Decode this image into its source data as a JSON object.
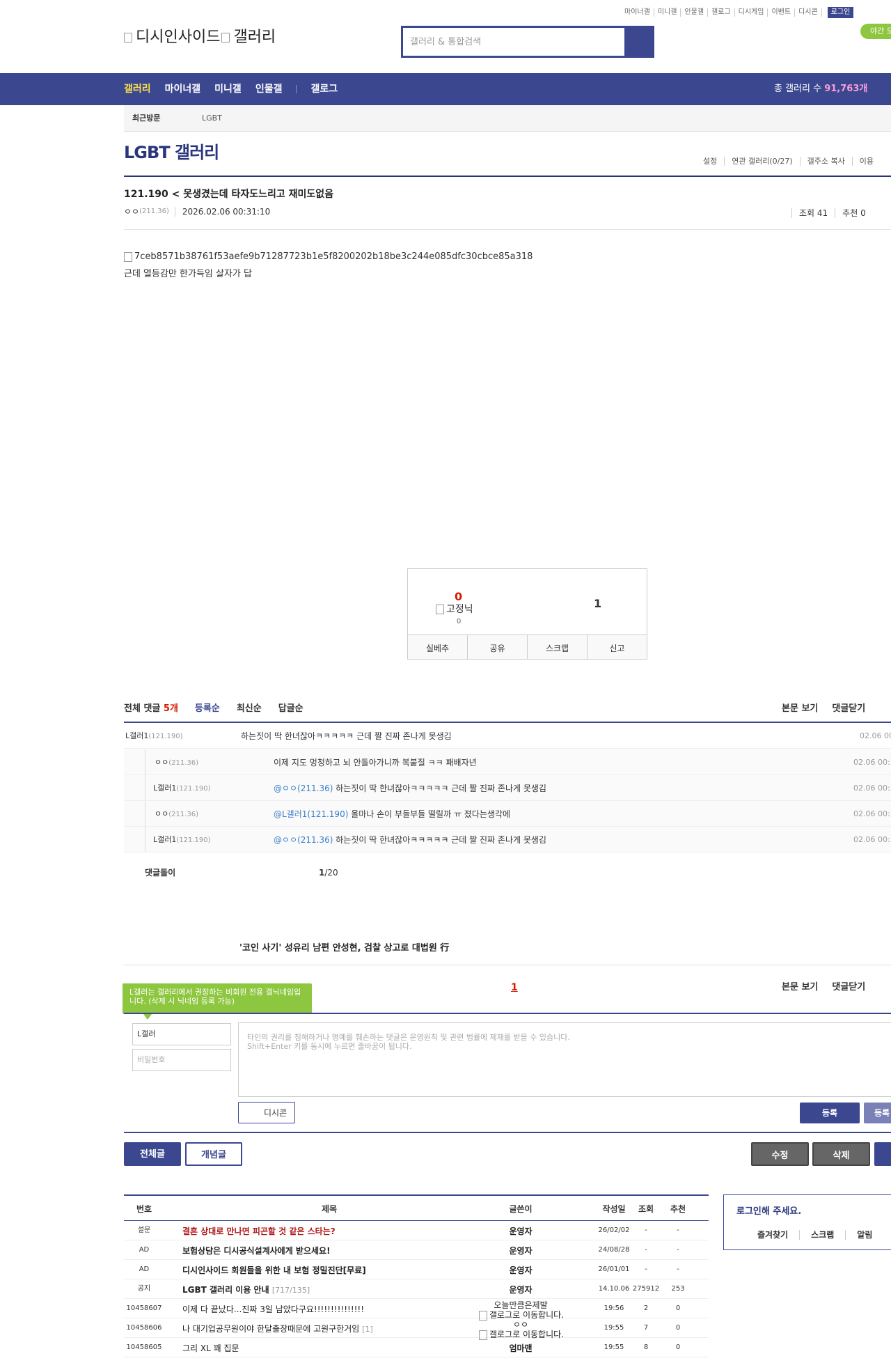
{
  "util_links": [
    "마이너갤",
    "미니갤",
    "인물갤",
    "갤로그",
    "디시게임",
    "이벤트",
    "디시콘"
  ],
  "login_label": "로그인",
  "night_mode": "야간 모",
  "logo": {
    "left": "디시인사이드",
    "right": "갤러리"
  },
  "search": {
    "placeholder": "갤러리 & 통합검색"
  },
  "nav": {
    "items": [
      "갤러리",
      "마이너갤",
      "미니갤",
      "인물갤",
      "갤로그"
    ],
    "total_label": "총 갤러리 수",
    "total_value": "91,763개"
  },
  "recent": {
    "title": "최근방문",
    "item": "LGBT"
  },
  "gallery": {
    "title": "LGBT 갤러리",
    "menu": [
      "설정",
      "연관 갤러리(0/27)",
      "갤주소 복사",
      "이용"
    ]
  },
  "post": {
    "title": "121.190 < 못생겼는데 타자도느리고 재미도없음",
    "author": "ㅇㅇ",
    "author_ip": "(211.36)",
    "date": "2026.02.06 00:31:10",
    "views": "조회 41",
    "recommend": "추천 0",
    "image_alt": "7ceb8571b38761f53aefe9b71287723b1e5f8200202b18be3c244e085dfc30cbce85a318",
    "body": "근데 열등감만 한가득임 살자가 답"
  },
  "recommend_box": {
    "up": "0",
    "fix_label": "고정닉",
    "fix_count": "0",
    "down": "1",
    "buttons": [
      "실베추",
      "공유",
      "스크랩",
      "신고"
    ]
  },
  "comments": {
    "total_label": "전체 댓글",
    "total_count": "5개",
    "sorts": [
      "등록순",
      "최신순",
      "답글순"
    ],
    "right_links": [
      "본문 보기",
      "댓글닫기"
    ],
    "items": [
      {
        "nick": "L갤러1",
        "ip": "(121.190)",
        "at": "",
        "text": "하는짓이 딱 한녀잖아ㅋㅋㅋㅋㅋ 근데 짤 진짜 존나게 못생김",
        "time": "02.06 00"
      },
      {
        "nick": "ㅇㅇ",
        "ip": "(211.36)",
        "at": "",
        "text": "이제 지도 멍청하고 뇌 안돌아가니까 복붙질 ㅋㅋ 패배자년",
        "time": "02.06 00:3"
      },
      {
        "nick": "L갤러1",
        "ip": "(121.190)",
        "at": "@ㅇㅇ(211.36)",
        "text": " 하는짓이 딱 한녀잖아ㅋㅋㅋㅋㅋ 근데 짤 진짜 존나게 못생김",
        "time": "02.06 00:3"
      },
      {
        "nick": "ㅇㅇ",
        "ip": "(211.36)",
        "at": "@L갤러1(121.190)",
        "text": " 올마나 손이 부들부들 떨릴까 ㅠ 졌다는생각에",
        "time": "02.06 00:3"
      },
      {
        "nick": "L갤러1",
        "ip": "(121.190)",
        "at": "@ㅇㅇ(211.36)",
        "text": " 하는짓이 딱 한녀잖아ㅋㅋㅋㅋㅋ 근데 짤 진짜 존나게 못생김",
        "time": "02.06 00:3"
      }
    ],
    "fold_label": "댓글돌이",
    "page_current": "1",
    "page_total": "/20"
  },
  "news_headline": "'코인 사기' 성유리 남편 안성현, 검찰 상고로 대법원 行",
  "write": {
    "tip": "L갤러는 갤러리에서 권장하는 비회원 전용 갤닉네임입니다. (삭제 시 닉네임 등록 가능)",
    "page_num": "1",
    "right_links": [
      "본문 보기",
      "댓글닫기"
    ],
    "nick_value": "L갤러",
    "pw_placeholder": "비밀번호",
    "textarea_line1": "타인의 권리를 침해하거나 명예를 훼손하는 댓글은 운영원칙 및 관련 법률에 제재를 받을 수 있습니다.",
    "textarea_line2": "Shift+Enter 키를 동시에 누르면 줄바꿈이 됩니다.",
    "dccon": "디시콘",
    "register": "등록",
    "register2": "등록"
  },
  "buttons": {
    "all": "전체글",
    "best": "개념글",
    "edit": "수정",
    "delete": "삭제"
  },
  "list": {
    "headers": [
      "번호",
      "제목",
      "글쓴이",
      "작성일",
      "조회",
      "추천"
    ],
    "rows": [
      {
        "no": "설문",
        "title": "결혼 상대로 만나면 피곤할 것 같은 스타는?",
        "cnt": "",
        "writer": "운영자",
        "writer2": "",
        "date": "26/02/02",
        "views": "-",
        "rec": "-",
        "style": "red"
      },
      {
        "no": "AD",
        "title": "보험상담은 디시공식설계사에게 받으세요!",
        "cnt": "",
        "writer": "운영자",
        "writer2": "",
        "date": "24/08/28",
        "views": "-",
        "rec": "-",
        "style": "bold"
      },
      {
        "no": "AD",
        "title": "디시인사이드 회원들을 위한 내 보험 정밀진단[무료]",
        "cnt": "",
        "writer": "운영자",
        "writer2": "",
        "date": "26/01/01",
        "views": "-",
        "rec": "-",
        "style": "bold"
      },
      {
        "no": "공지",
        "title": "LGBT 갤러리 이용 안내",
        "cnt": "[717/135]",
        "writer": "운영자",
        "writer2": "",
        "date": "14.10.06",
        "views": "275912",
        "rec": "253",
        "style": "bold"
      },
      {
        "no": "10458607",
        "title": "이제 다 끝났다...진짜 3일 남았다구요!!!!!!!!!!!!!!!",
        "cnt": "",
        "writer": "오늘만큼은제발",
        "writer2": "갤로그로 이동합니다.",
        "date": "19:56",
        "views": "2",
        "rec": "0",
        "style": "norm"
      },
      {
        "no": "10458606",
        "title": "나 대기업공무원이야 한달출장때문에 고원구한거임",
        "cnt": "[1]",
        "writer": "ㅇㅇ",
        "writer2": "갤로그로 이동합니다.",
        "date": "19:55",
        "views": "7",
        "rec": "0",
        "style": "norm"
      },
      {
        "no": "10458605",
        "title": "그리 XL 꽤 집문",
        "cnt": "",
        "writer": "엄마맨",
        "writer2": "",
        "date": "19:55",
        "views": "8",
        "rec": "0",
        "style": "norm"
      }
    ]
  },
  "login_box": {
    "title": "로그인해 주세요.",
    "menu": [
      "즐겨찾기",
      "스크랩",
      "알림"
    ]
  }
}
